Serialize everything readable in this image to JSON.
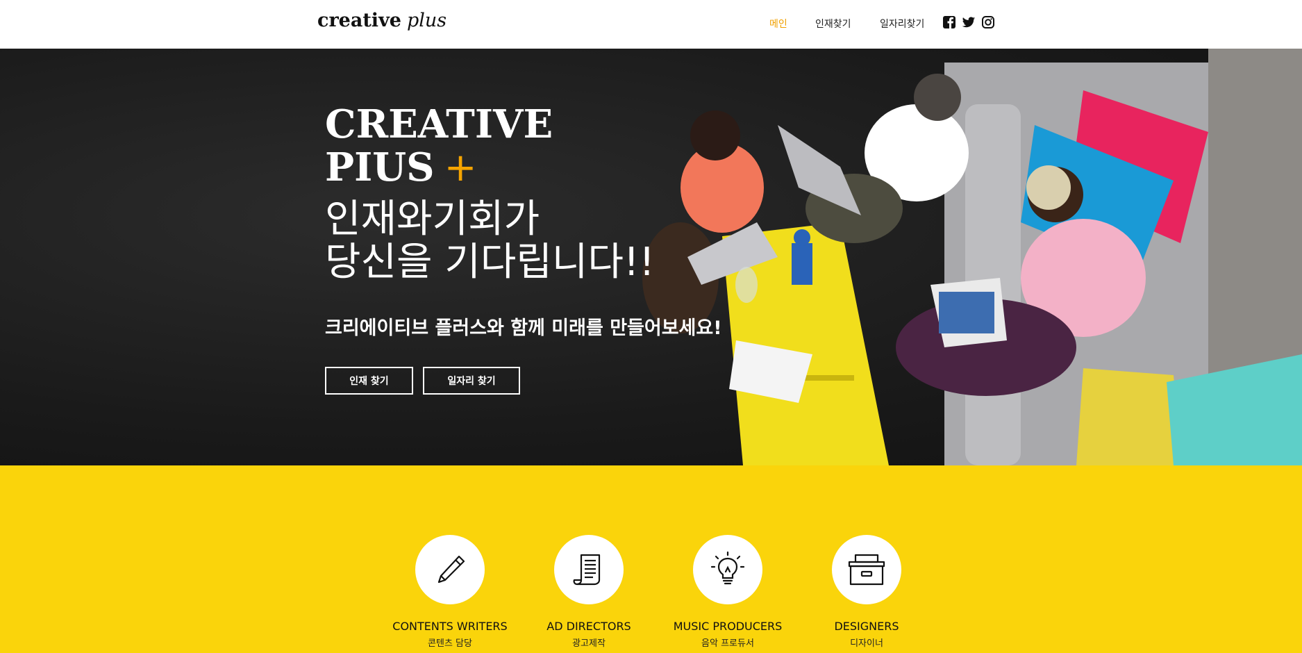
{
  "header": {
    "logo_main": "creative",
    "logo_sub": "plus",
    "nav": [
      {
        "label": "메인"
      },
      {
        "label": "인재찾기"
      },
      {
        "label": "일자리찾기"
      }
    ],
    "social": [
      "facebook-icon",
      "twitter-icon",
      "instagram-icon"
    ],
    "accent_color": "#f0a000"
  },
  "hero": {
    "line1": "CREATIVE",
    "line2": "PIUS",
    "plus_sign": "+",
    "line3": "인재와기회가",
    "line4": "당신을 기다립니다!!",
    "subtitle": "크리에이티브 플러스와 함께 미래를 만들어보세요!",
    "buttons": [
      {
        "label": "인재 찾기"
      },
      {
        "label": "일자리 찾기"
      }
    ]
  },
  "categories": {
    "background_color": "#fad40b",
    "items": [
      {
        "title": "CONTENTS WRITERS",
        "subtitle": "콘텐츠 담당",
        "icon": "pencil-icon"
      },
      {
        "title": "AD DIRECTORS",
        "subtitle": "광고제작",
        "icon": "scroll-icon"
      },
      {
        "title": "MUSIC PRODUCERS",
        "subtitle": "음악 프로듀서",
        "icon": "lightbulb-icon"
      },
      {
        "title": "DESIGNERS",
        "subtitle": "디자이너",
        "icon": "archive-box-icon"
      }
    ]
  }
}
